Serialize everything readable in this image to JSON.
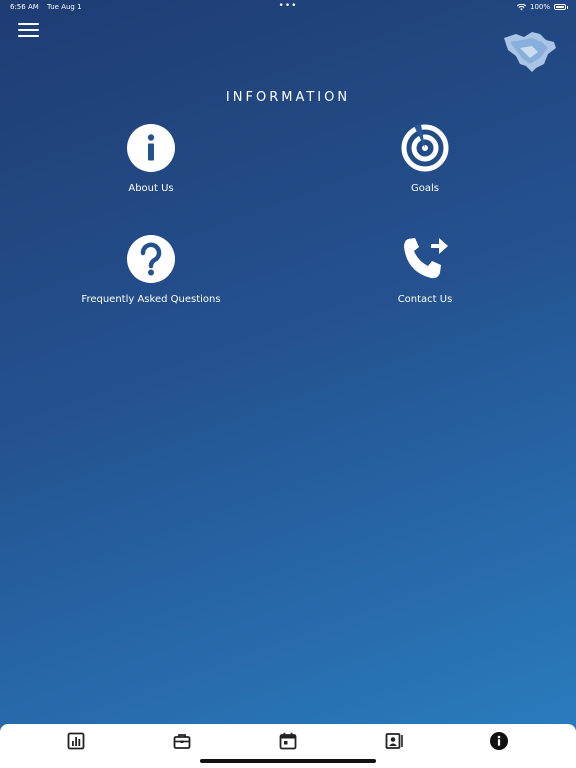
{
  "status_bar": {
    "time": "6:56 AM",
    "date": "Tue Aug 1",
    "dots": "•••",
    "battery": "100%"
  },
  "header": {
    "menu_icon": "hamburger-menu-icon",
    "logo_icon": "state-map-logo"
  },
  "main": {
    "title": "INFORMATION",
    "tiles": [
      {
        "label": "About Us",
        "icon": "info-circle-icon"
      },
      {
        "label": "Goals",
        "icon": "target-icon"
      },
      {
        "label": "Frequently Asked Questions",
        "icon": "question-circle-icon"
      },
      {
        "label": "Contact Us",
        "icon": "phone-forward-icon"
      }
    ]
  },
  "tab_bar": {
    "tabs": [
      {
        "icon": "bar-chart-icon"
      },
      {
        "icon": "briefcase-icon"
      },
      {
        "icon": "calendar-icon"
      },
      {
        "icon": "contact-card-icon"
      },
      {
        "icon": "info-circle-icon",
        "active": true
      }
    ]
  },
  "colors": {
    "gradient_start": "#1f3c74",
    "gradient_end": "#2a7fc2",
    "tab_icon": "#222222"
  }
}
